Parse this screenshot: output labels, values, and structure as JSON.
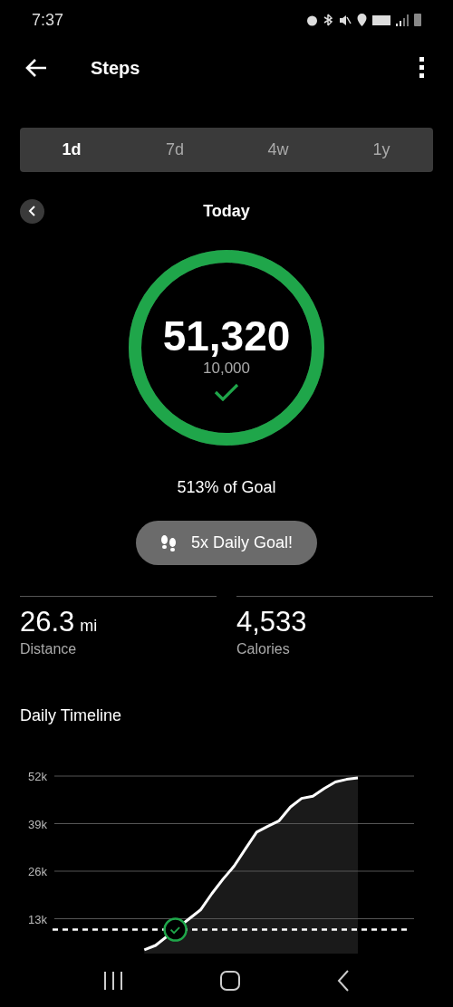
{
  "status_bar": {
    "time": "7:37"
  },
  "header": {
    "title": "Steps"
  },
  "tabs": [
    {
      "label": "1d",
      "selected": true
    },
    {
      "label": "7d",
      "selected": false
    },
    {
      "label": "4w",
      "selected": false
    },
    {
      "label": "1y",
      "selected": false
    }
  ],
  "period": {
    "label": "Today"
  },
  "goal_ring": {
    "level": 1,
    "steps": "51,320",
    "goal": "10,000",
    "achieved": true
  },
  "goal_percent": "513% of Goal",
  "badge": {
    "label": "5x Daily Goal!"
  },
  "stats": [
    {
      "value": "26.3",
      "unit": "mi",
      "label": "Distance"
    },
    {
      "value": "4,533",
      "label": "Calories"
    }
  ],
  "timeline": {
    "title": "Daily Timeline",
    "chart_data": {
      "type": "area",
      "grid": true,
      "ylim": [
        0,
        52000
      ],
      "yticks": [
        {
          "value": 13000,
          "label": "13k"
        },
        {
          "value": 26000,
          "label": "26k"
        },
        {
          "value": 39000,
          "label": "39k"
        },
        {
          "value": 52000,
          "label": "52k"
        }
      ],
      "categories": [
        null,
        null,
        null,
        null,
        null,
        null,
        null,
        null,
        null,
        null,
        null,
        null,
        null,
        null,
        null,
        null,
        null,
        null,
        null,
        null,
        null,
        null,
        null,
        null,
        null,
        null,
        null,
        null,
        null,
        null,
        null,
        null,
        null
      ],
      "series": [
        {
          "color": "#ffffff",
          "values": [
            null,
            null,
            null,
            null,
            null,
            null,
            null,
            null,
            4500,
            5700,
            null,
            null,
            13000,
            15400,
            19800,
            23800,
            27400,
            32100,
            36700,
            38300,
            39800,
            43500,
            45900,
            46500,
            48600,
            50400,
            51100,
            51500,
            null,
            null,
            null,
            null,
            null
          ]
        }
      ],
      "ref_lines": [
        {
          "axis": "y",
          "value": 10000
        }
      ]
    }
  }
}
